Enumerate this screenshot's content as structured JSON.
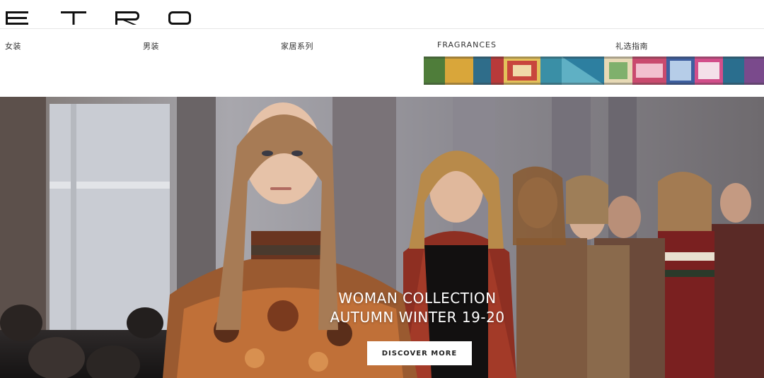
{
  "brand": {
    "logo_text": "ETRO"
  },
  "nav": {
    "items": [
      {
        "label": "女装"
      },
      {
        "label": "男装"
      },
      {
        "label": "家居系列"
      },
      {
        "label": "FRAGRANCES"
      },
      {
        "label": "礼选指南"
      }
    ]
  },
  "hero": {
    "title_line1": "WOMAN COLLECTION",
    "title_line2": "AUTUMN WINTER 19-20",
    "cta_label": "DISCOVER MORE"
  },
  "colors": {
    "background": "#ffffff",
    "nav_text": "#333333",
    "hero_text": "#ffffff",
    "button_bg": "#ffffff"
  }
}
